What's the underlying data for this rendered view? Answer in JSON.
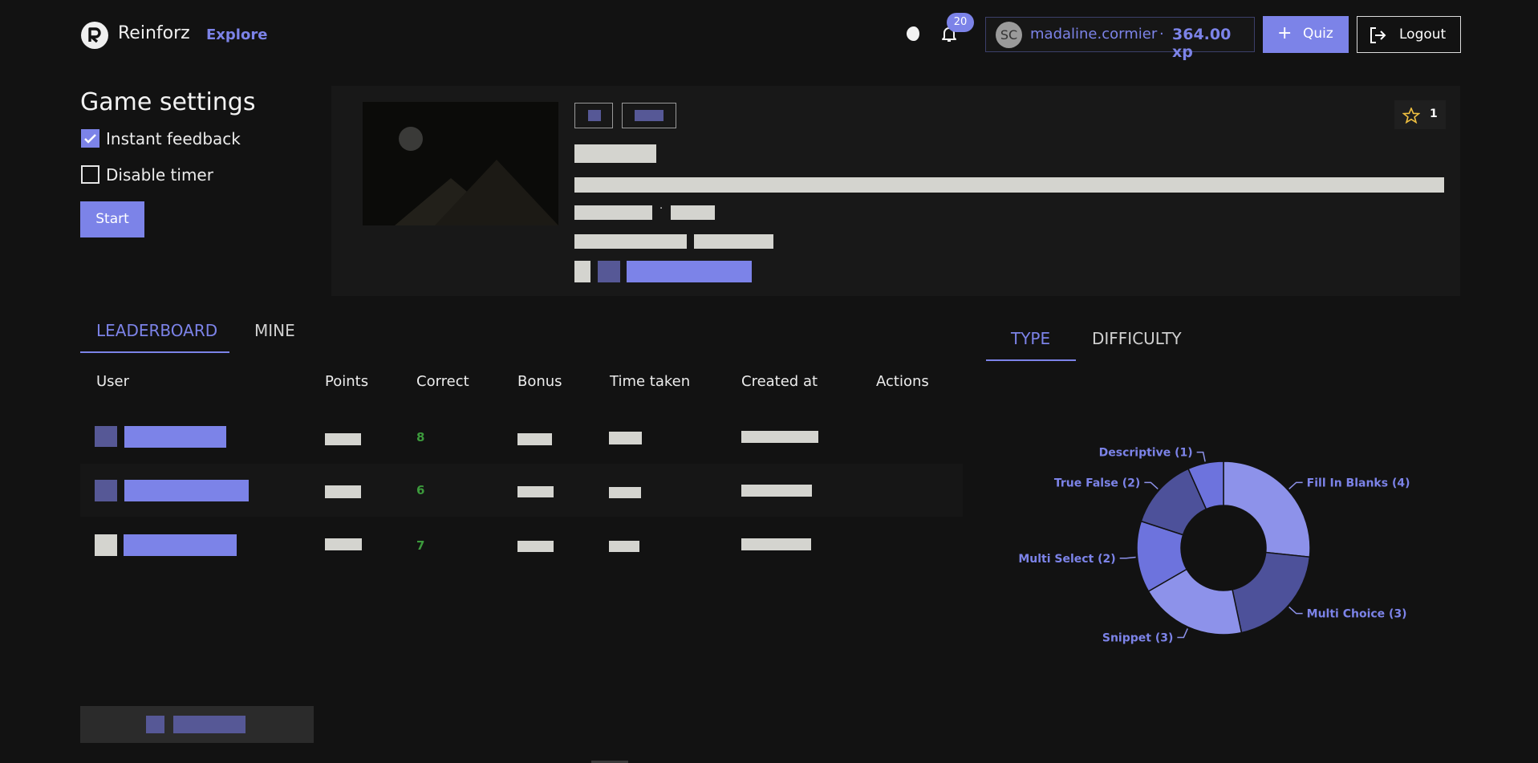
{
  "header": {
    "brand": "Reinforz",
    "explore": "Explore",
    "notification_count": "20",
    "avatar_initials": "SC",
    "username": "madaline.cormier",
    "separator": "·",
    "xp": "364.00 xp",
    "quiz_label": "Quiz",
    "logout_label": "Logout"
  },
  "settings": {
    "title": "Game settings",
    "instant_feedback": {
      "label": "Instant feedback",
      "checked": true
    },
    "disable_timer": {
      "label": "Disable timer",
      "checked": false
    },
    "start_label": "Start"
  },
  "quiz_card": {
    "separator": "·",
    "star_count": "1"
  },
  "leaderboard": {
    "tabs": [
      "LEADERBOARD",
      "MINE"
    ],
    "columns": [
      "User",
      "Points",
      "Correct",
      "Bonus",
      "Time taken",
      "Created at",
      "Actions"
    ],
    "rows": [
      {
        "correct": "8"
      },
      {
        "correct": "6"
      },
      {
        "correct": "7"
      }
    ]
  },
  "stats": {
    "tabs": [
      "TYPE",
      "DIFFICULTY"
    ]
  },
  "chart_data": {
    "type": "pie",
    "donut": true,
    "slices": [
      {
        "label": "Fill In Blanks (4)",
        "value": 4,
        "color": "#8d92ea"
      },
      {
        "label": "Multi Choice (3)",
        "value": 3,
        "color": "#4d519a"
      },
      {
        "label": "Snippet (3)",
        "value": 3,
        "color": "#8d92ea"
      },
      {
        "label": "Multi Select (2)",
        "value": 2,
        "color": "#6d73dd"
      },
      {
        "label": "True False (2)",
        "value": 2,
        "color": "#4d519a"
      },
      {
        "label": "Descriptive (1)",
        "value": 1,
        "color": "#6d73dd"
      }
    ]
  },
  "colors": {
    "accent": "#7c83e8",
    "background": "#121212",
    "correct": "#3c9a3c"
  }
}
